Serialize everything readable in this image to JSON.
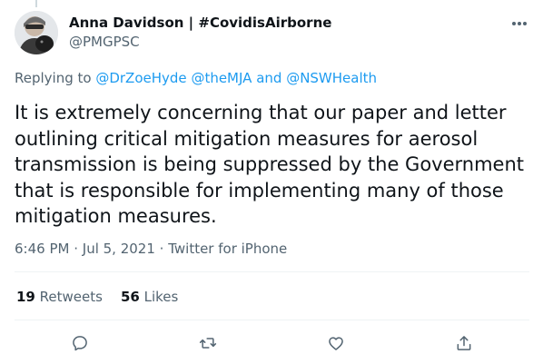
{
  "author": {
    "display_name": "Anna Davidson | #CovidisAirborne",
    "handle": "@PMGPSC"
  },
  "reply_context": {
    "prefix": "Replying to ",
    "mentions": [
      "@DrZoeHyde",
      "@theMJA",
      "@NSWHealth"
    ],
    "separator_space": " ",
    "and_word": " and "
  },
  "tweet": {
    "text": "It is extremely concerning that our paper and letter outlining critical mitigation measures for aerosol transmission is being suppressed by the Government that is responsible for implementing many of those mitigation measures."
  },
  "meta": {
    "time": "6:46 PM",
    "date": "Jul 5, 2021",
    "source": "Twitter for iPhone",
    "dot": " · "
  },
  "stats": {
    "retweets_count": "19",
    "retweets_label": "Retweets",
    "likes_count": "56",
    "likes_label": "Likes"
  },
  "icons": {
    "more": "more-options-icon",
    "reply": "reply-icon",
    "retweet": "retweet-icon",
    "like": "like-icon",
    "share": "share-icon"
  },
  "colors": {
    "link": "#1d9bf0",
    "secondary_text": "#536471",
    "primary_text": "#0f1419",
    "divider": "#eff3f4"
  }
}
